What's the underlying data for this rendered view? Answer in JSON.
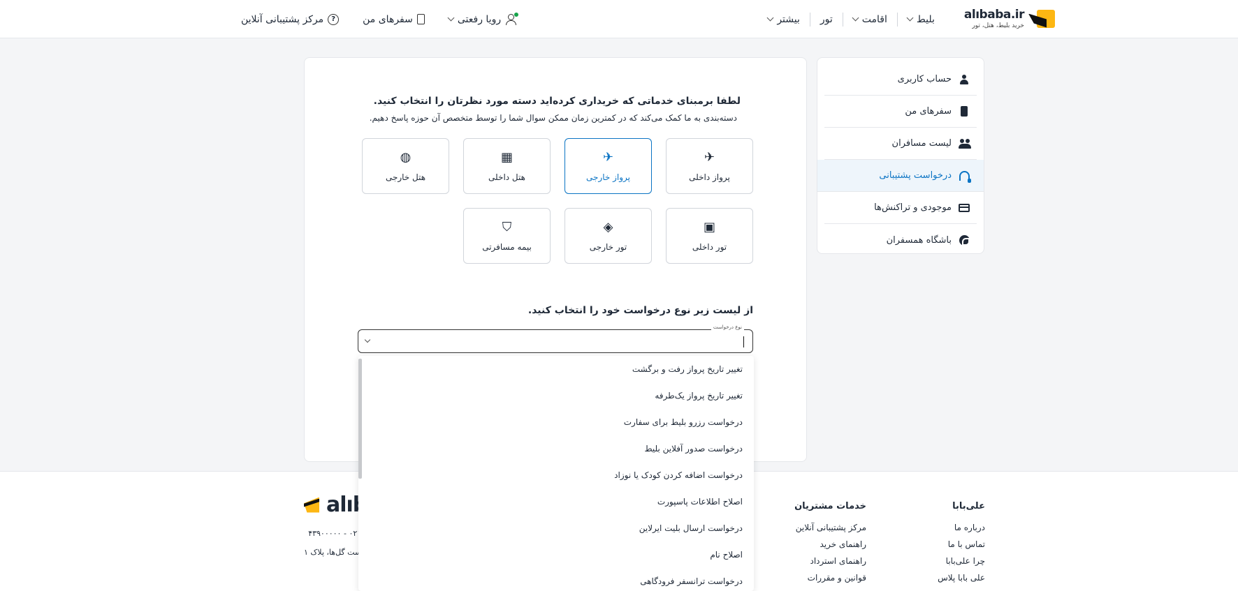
{
  "header": {
    "logo_text": "alıbaba.ir",
    "logo_tagline": "خرید بلیط، هتل، تور",
    "nav": [
      {
        "label": "بلیط"
      },
      {
        "label": "اقامت"
      },
      {
        "label": "تور"
      },
      {
        "label": "بیشتر"
      }
    ],
    "support_link": "مرکز پشتیبانی آنلاین",
    "trips_link": "سفرهای من",
    "user_name": "رویا رفعتی"
  },
  "sidebar": {
    "items": [
      {
        "label": "حساب کاربری"
      },
      {
        "label": "سفرهای من"
      },
      {
        "label": "لیست مسافران"
      },
      {
        "label": "درخواست پشتیبانی"
      },
      {
        "label": "موجودی و تراکنش‌ها"
      },
      {
        "label": "باشگاه همسفران"
      }
    ]
  },
  "main": {
    "title": "لطفا برمبنای خدماتی که خریداری کرده‌اید دسته مورد نظرتان را انتخاب کنید.",
    "subtitle": "دسته‌بندی به ما کمک می‌کند که در کمترین زمان ممکن سوال شما را توسط متخصص آن حوزه پاسخ دهیم.",
    "categories": [
      {
        "label": "پرواز داخلی",
        "icon": "plane-icon"
      },
      {
        "label": "پرواز خارجی",
        "icon": "plane-international-icon",
        "selected": true
      },
      {
        "label": "هتل داخلی",
        "icon": "hotel-icon"
      },
      {
        "label": "هتل خارجی",
        "icon": "hotel-international-icon"
      },
      {
        "label": "تور داخلی",
        "icon": "suitcase-icon"
      },
      {
        "label": "تور خارجی",
        "icon": "suitcase-globe-icon"
      },
      {
        "label": "بیمه مسافرتی",
        "icon": "shield-check-icon"
      }
    ],
    "request_heading": "از لیست زیر نوع درخواست خود را انتخاب کنید.",
    "select_label": "نوع درخواست",
    "options": [
      "تغییر تاریخ پرواز رفت و برگشت",
      "تغییر تاریخ پرواز یک‌طرفه",
      "درخواست رزرو بلیط برای سفارت",
      "درخواست صدور آفلاین بلیط",
      "درخواست اضافه کردن کودک یا نوزاد",
      "اصلاح اطلاعات پاسپورت",
      "درخواست ارسال بلیت ایرلاین",
      "اصلاح نام",
      "درخواست ترانسفر فرودگاهی"
    ]
  },
  "footer": {
    "logo_text": "alıb",
    "phone": "۰۲۱ - ۴۳۹۰۰۰۰۰",
    "address": "ست گل‌ها، پلاک ۱",
    "col1": {
      "title": "علی‌بابا",
      "links": [
        "درباره ما",
        "تماس با ما",
        "چرا علی‌بابا",
        "علی بابا پلاس"
      ]
    },
    "col2": {
      "title": "خدمات مشتریان",
      "links": [
        "مرکز پشتیبانی آنلاین",
        "راهنمای خرید",
        "راهنمای استرداد",
        "قوانین و مقررات"
      ]
    }
  },
  "colors": {
    "accent": "#0b74c4",
    "brand_yellow": "#fdb713"
  }
}
